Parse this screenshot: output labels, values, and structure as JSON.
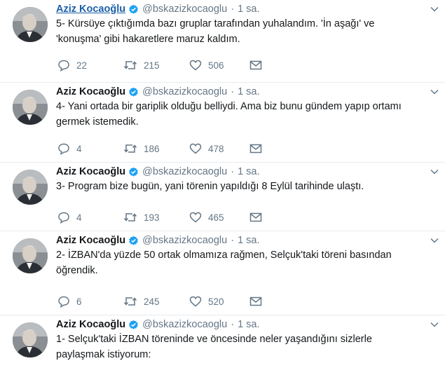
{
  "tweets": [
    {
      "author_name": "Aziz Kocaoğlu",
      "handle": "@bskazizkocaoglu",
      "separator": "·",
      "time": "1 sa.",
      "text": "5- Kürsüye çıktığımda bazı gruplar tarafından yuhalandım. 'İn aşağı' ve 'konuşma' gibi hakaretlere maruz kaldım.",
      "replies": "22",
      "retweets": "215",
      "likes": "506"
    },
    {
      "author_name": "Aziz Kocaoğlu",
      "handle": "@bskazizkocaoglu",
      "separator": "·",
      "time": "1 sa.",
      "text": "4- Yani ortada bir gariplik olduğu belliydi. Ama biz bunu gündem yapıp ortamı germek istemedik.",
      "replies": "4",
      "retweets": "186",
      "likes": "478"
    },
    {
      "author_name": "Aziz Kocaoğlu",
      "handle": "@bskazizkocaoglu",
      "separator": "·",
      "time": "1 sa.",
      "text": "3- Program bize bugün, yani törenin yapıldığı 8 Eylül tarihinde ulaştı.",
      "replies": "4",
      "retweets": "193",
      "likes": "465"
    },
    {
      "author_name": "Aziz Kocaoğlu",
      "handle": "@bskazizkocaoglu",
      "separator": "·",
      "time": "1 sa.",
      "text": "2-  İZBAN'da yüzde 50 ortak olmamıza rağmen, Selçuk'taki töreni basından öğrendik.",
      "replies": "6",
      "retweets": "245",
      "likes": "520"
    },
    {
      "author_name": "Aziz Kocaoğlu",
      "handle": "@bskazizkocaoglu",
      "separator": "·",
      "time": "1 sa.",
      "text": "1- Selçuk'taki İZBAN töreninde ve öncesinde neler yaşandığını sizlerle paylaşmak istiyorum:"
    }
  ],
  "icons": {
    "verified": "verified-badge-icon",
    "caret": "chevron-down-icon",
    "reply": "reply-icon",
    "retweet": "retweet-icon",
    "like": "heart-icon",
    "dm": "envelope-icon"
  },
  "colors": {
    "name_link": "#1b5fa8",
    "text": "#14171a",
    "secondary": "#657786",
    "verified": "#1da1f2",
    "divider": "#e6ecf0"
  }
}
